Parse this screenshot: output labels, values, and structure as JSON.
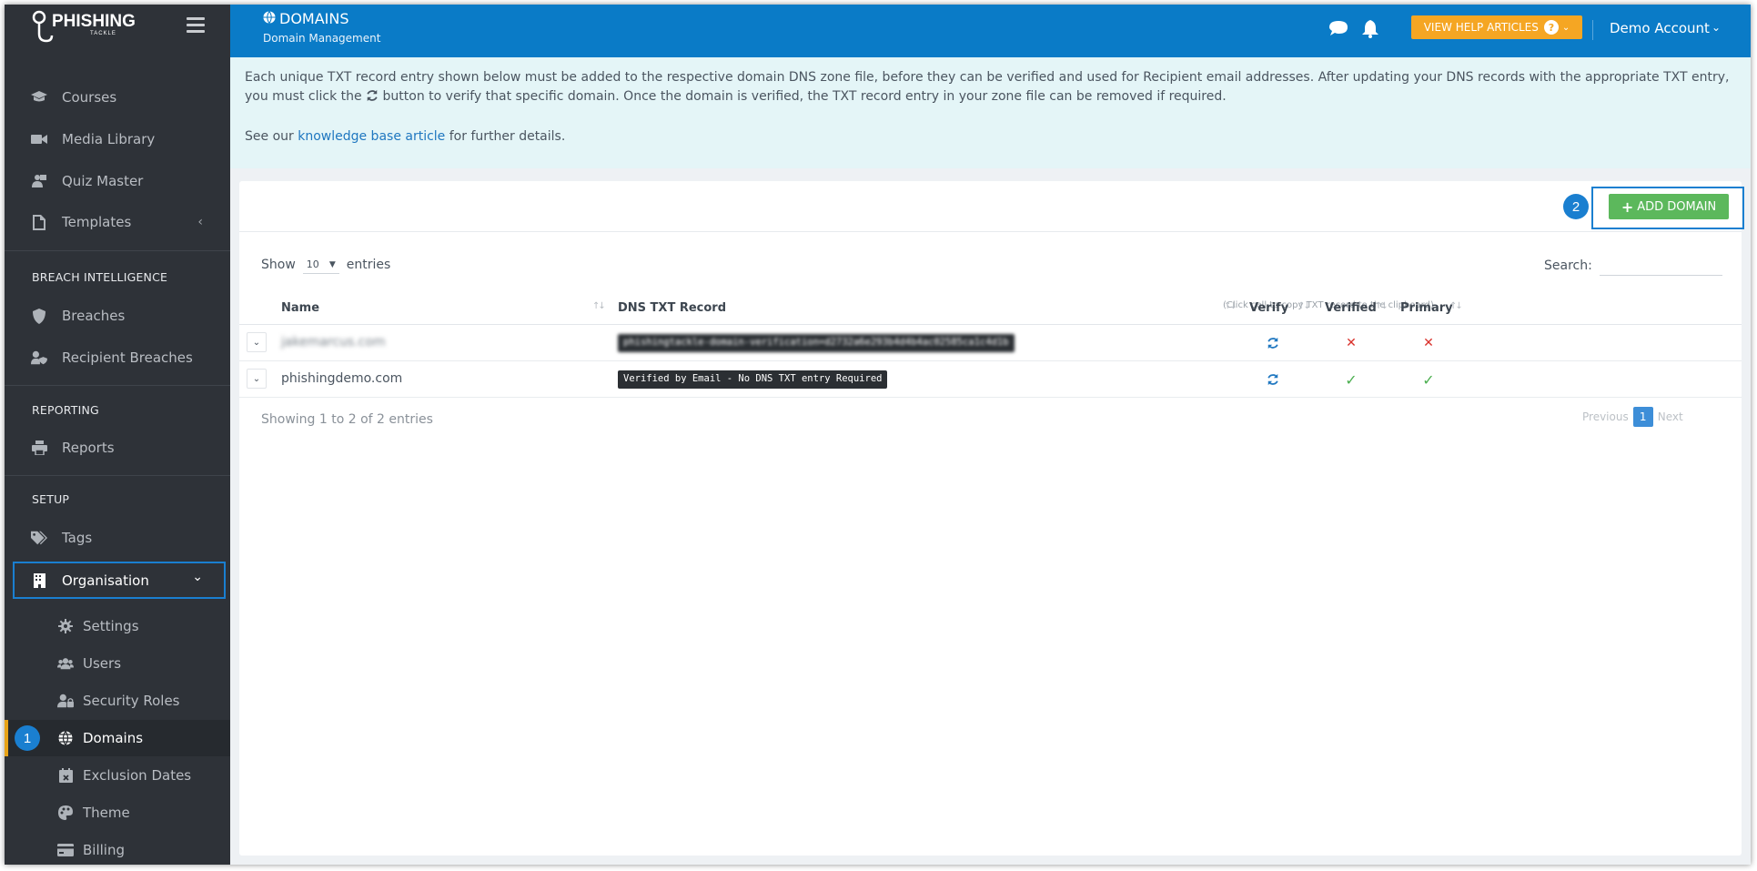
{
  "sidebar": {
    "brand": "PHISHING",
    "brand_sub": "TACKLE",
    "items_top": [
      {
        "label": "Courses",
        "icon": "graduation-cap-icon"
      },
      {
        "label": "Media Library",
        "icon": "video-camera-icon"
      },
      {
        "label": "Quiz Master",
        "icon": "teacher-icon"
      },
      {
        "label": "Templates",
        "icon": "file-icon",
        "chevron": "‹"
      }
    ],
    "section_breach": "BREACH INTELLIGENCE",
    "items_breach": [
      {
        "label": "Breaches",
        "icon": "shield-icon"
      },
      {
        "label": "Recipient Breaches",
        "icon": "user-shield-icon"
      }
    ],
    "section_reporting": "REPORTING",
    "items_reporting": [
      {
        "label": "Reports",
        "icon": "printer-icon"
      }
    ],
    "section_setup": "SETUP",
    "items_setup": [
      {
        "label": "Tags",
        "icon": "tags-icon"
      },
      {
        "label": "Organisation",
        "icon": "building-icon",
        "chevron": "⌄"
      }
    ],
    "items_org": [
      {
        "label": "Settings",
        "icon": "gear-icon"
      },
      {
        "label": "Users",
        "icon": "users-icon"
      },
      {
        "label": "Security Roles",
        "icon": "user-lock-icon"
      },
      {
        "label": "Domains",
        "icon": "globe-icon"
      },
      {
        "label": "Exclusion Dates",
        "icon": "calendar-x-icon"
      },
      {
        "label": "Theme",
        "icon": "palette-icon"
      },
      {
        "label": "Billing",
        "icon": "credit-card-icon"
      }
    ],
    "step_badge": "1"
  },
  "header": {
    "title": "DOMAINS",
    "subtitle": "Domain Management",
    "help_button": "VIEW HELP ARTICLES",
    "help_q": "?",
    "account": "Demo Account"
  },
  "notice": {
    "line1_before": "Each unique TXT record entry shown below must be added to the respective domain DNS zone file, before they can be verified and used for Recipient email addresses. After updating your DNS records with the appropriate TXT entry, you must click the",
    "line1_after": "button to verify that specific domain. Once the domain is verified, the TXT record entry in your zone file can be removed if required.",
    "see_before": "See our",
    "link": "knowledge base article",
    "see_after": "for further details."
  },
  "toolbar": {
    "add_domain": "ADD DOMAIN",
    "step_badge": "2"
  },
  "table": {
    "show_label": "Show",
    "entries_label": "entries",
    "page_size": "10",
    "search_label": "Search:",
    "columns": {
      "name": "Name",
      "txt": "DNS TXT Record",
      "txt_note": "(Click cell to copy TXT record to the clipboard)",
      "verify": "Verify",
      "verified": "Verified",
      "primary": "Primary"
    },
    "rows": [
      {
        "name": "jakemarcus.com",
        "txt": "phishingtackle-domain-verification=d2732a6e293b4d4b4ac02585ca1c4d1b",
        "verified": false,
        "primary": false
      },
      {
        "name": "phishingdemo.com",
        "txt": "Verified by Email - No DNS TXT entry Required",
        "verified": true,
        "primary": true
      }
    ],
    "info": "Showing 1 to 2 of 2 entries",
    "pager": {
      "previous": "Previous",
      "page": "1",
      "next": "Next"
    }
  },
  "colors": {
    "header_blue": "#0a7bc7",
    "sidebar": "#2e3238",
    "accent_orange": "#f5a623",
    "add_green": "#5cb85c",
    "highlight_blue": "#1a7fd0"
  }
}
